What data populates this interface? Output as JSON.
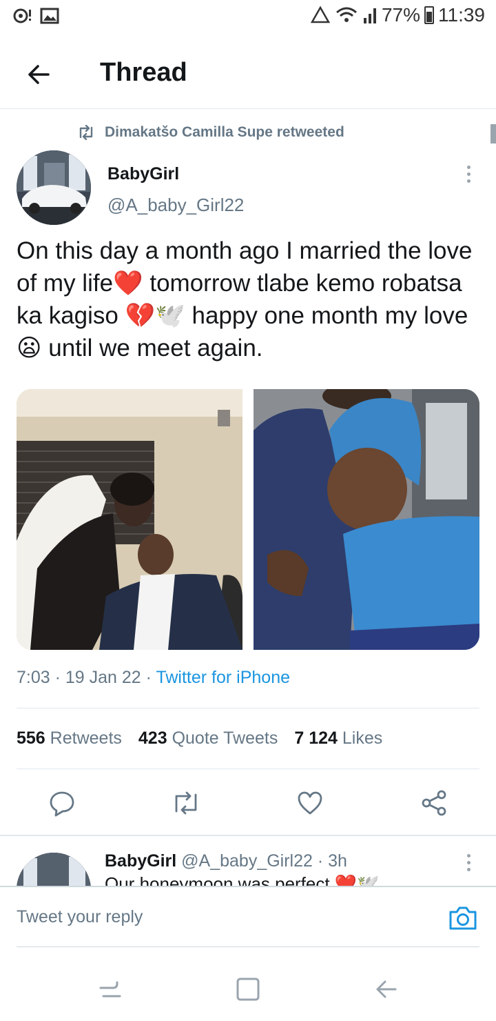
{
  "status_bar": {
    "battery": "77%",
    "time": "11:39"
  },
  "header": {
    "title": "Thread"
  },
  "retweet": {
    "label": "Dimakatšo Camilla Supe retweeted"
  },
  "tweet": {
    "author_name": "BabyGirl",
    "author_handle": "@A_baby_Girl22",
    "text_part1": "On this day a month ago I married the love of my life",
    "emoji_heart": "❤️",
    "text_part2": " tomorrow tlabe kemo robatsa ka kagiso ",
    "emoji_broken": "💔🕊️",
    "text_part3": " happy one month my love",
    "emoji_sad": "😦",
    "text_part4": " until we meet again.",
    "time": "7:03",
    "date": "19 Jan 22",
    "source": "Twitter for iPhone",
    "stats": {
      "retweets_count": "556",
      "retweets_label": "Retweets",
      "quotes_count": "423",
      "quotes_label": "Quote Tweets",
      "likes_count": "7 124",
      "likes_label": "Likes"
    }
  },
  "reply_tweet": {
    "author_name": "BabyGirl",
    "author_handle": "@A_baby_Girl22",
    "age": "3h",
    "text": "Our honeymoon was perfect ❤️🕊️"
  },
  "composer": {
    "placeholder": "Tweet your reply"
  },
  "icons": {
    "back": "arrow-left-icon",
    "retweet": "retweet-icon",
    "more": "more-vertical-icon",
    "reply": "reply-icon",
    "like": "heart-icon",
    "share": "share-icon",
    "camera": "camera-icon"
  },
  "colors": {
    "accent": "#1b95e0",
    "muted": "#657786",
    "text": "#14171a",
    "divider": "#e1e8ed"
  }
}
